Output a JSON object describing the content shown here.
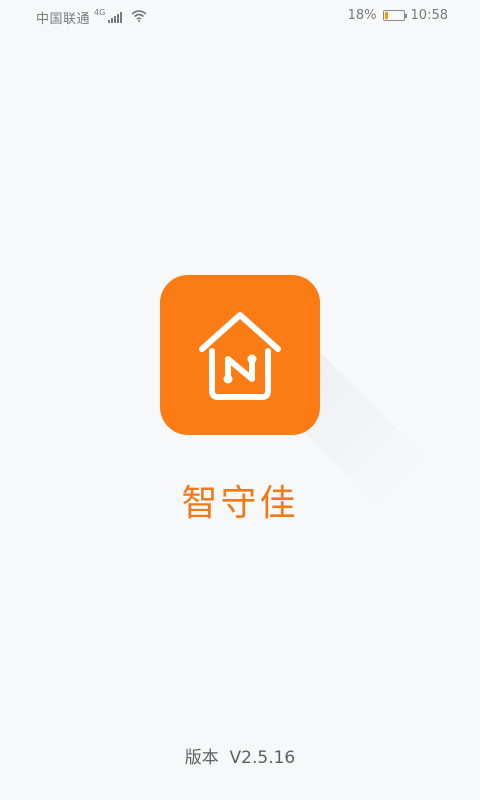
{
  "status_bar": {
    "carrier": "中国联通",
    "network_type": "4G",
    "battery_percent_text": "18%",
    "battery_level": 0.18,
    "time": "10:58",
    "icons": [
      "signal-icon",
      "wifi-icon",
      "battery-icon"
    ]
  },
  "splash": {
    "app_name": "智守佳",
    "version_label": "版本",
    "version_number": "V2.5.16",
    "icon_name": "home-network-logo-icon",
    "brand_color": "#fb7b14",
    "title_color": "#f07a16"
  }
}
